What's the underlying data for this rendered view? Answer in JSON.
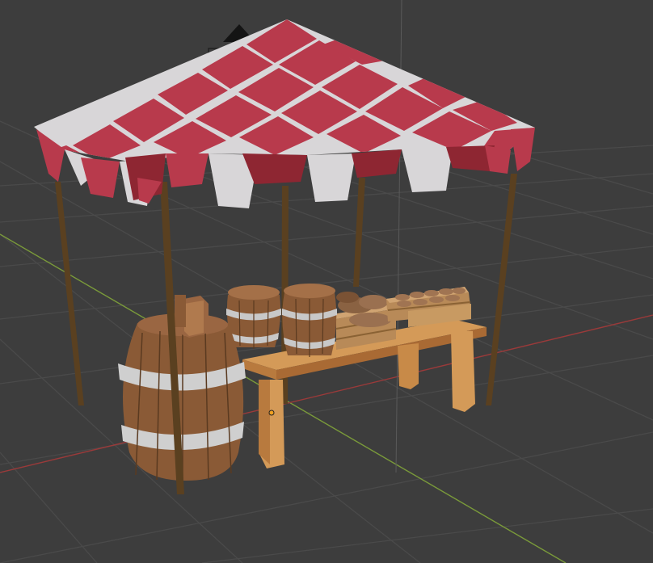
{
  "viewport": {
    "background_color": "#3d3d3d",
    "grid_color": "#4a4a4a",
    "x_axis_color": "#9a3a3a",
    "y_axis_color": "#7a9a3a"
  },
  "scene": {
    "canopy_colors": {
      "red": "#b83a4c",
      "white": "#d8d6d8",
      "dark_red": "#8e2632"
    },
    "pole_color": "#5a4020",
    "barrel_wood_color": "#8a5a36",
    "barrel_band_color": "#c8c8c8",
    "table_color": "#c88a48",
    "crate_color": "#b88a58",
    "bread_color": "#9a7050",
    "origin_dot_color": "#f0a020"
  }
}
